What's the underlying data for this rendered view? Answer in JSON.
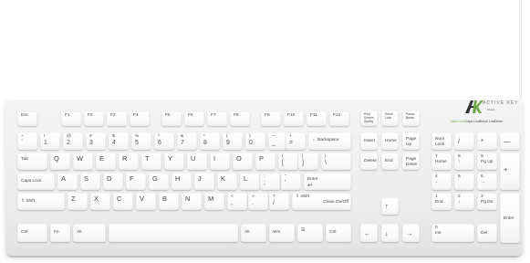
{
  "brand": {
    "name": "ACTIVE KEY",
    "sub": "Cherry"
  },
  "indicators": [
    {
      "label": "Num Lock",
      "color": "#6fa64a"
    },
    {
      "label": "Caps Lock",
      "color": "#444444"
    },
    {
      "label": "Scroll Lock",
      "color": "#444444"
    },
    {
      "label": "Clean",
      "color": "#444444"
    }
  ],
  "keys": {
    "esc": "Esc",
    "f1": "F1",
    "f2": "F2",
    "f3": "F3",
    "f4": "F4",
    "f5": "F5",
    "f6": "F6",
    "f7": "F7",
    "f8": "F8",
    "f9": "F9",
    "f10": "F10",
    "f11": "F11",
    "f12": "F12",
    "print": "Print Screen SysRq",
    "scroll": "Scroll Lock",
    "pause": "Pause Break",
    "grave": "~",
    "grave_sub": "`",
    "d1": "!",
    "d1_sub": "1",
    "d2": "@",
    "d2_sub": "2",
    "d3": "#",
    "d3_sub": "3",
    "d4": "$",
    "d4_sub": "4",
    "d5": "%",
    "d5_sub": "5",
    "d6": "^",
    "d6_sub": "6",
    "d7": "&",
    "d7_sub": "7",
    "d8": "*",
    "d8_sub": "8",
    "d9": "(",
    "d9_sub": "9",
    "d0": ")",
    "d0_sub": "0",
    "minus": "—",
    "minus_sub": "_",
    "equals": "+",
    "equals_sub": "=",
    "backspace": "← Backspace",
    "tab": "Tab",
    "q": "Q",
    "w": "W",
    "e": "E",
    "r": "R",
    "t": "T",
    "y": "Y",
    "u": "U",
    "i": "I",
    "o": "O",
    "p": "P",
    "lbracket": "{",
    "lbracket_sub": "[",
    "rbracket": "}",
    "rbracket_sub": "]",
    "backslash": "|",
    "backslash_sub": "\\",
    "caps": "Caps Lock",
    "a": "A",
    "s": "S",
    "d": "D",
    "f": "F",
    "g": "G",
    "h": "H",
    "j": "J",
    "k": "K",
    "l": "L",
    "semicolon": ":",
    "semicolon_sub": ";",
    "quote": "\"",
    "quote_sub": "'",
    "enter": "Enter",
    "lshift": "⇧ Shift",
    "z": "Z",
    "x": "X",
    "c": "C",
    "v": "V",
    "b": "B",
    "n": "N",
    "m": "M",
    "comma": "<",
    "comma_sub": ",",
    "period": ">",
    "period_sub": ".",
    "slash": "?",
    "slash_sub": "/",
    "rshift": "⇧ Shift",
    "clean": "Clean On/Off",
    "lctrl": "Ctrl",
    "fn": "Fn",
    "lalt": "Alt",
    "ralt": "Alt",
    "win": "Win",
    "menu": "☰",
    "rctrl": "Ctrl",
    "insert": "Insert",
    "home": "Home",
    "pgup": "Page Up",
    "delete": "Delete",
    "end": "End",
    "pgdn": "Page Down",
    "up": "↑",
    "left": "←",
    "down": "↓",
    "right": "→",
    "numlock": "Num Lock",
    "ndiv": "/",
    "nmul": "*",
    "nminus": "—",
    "n7": "7",
    "n7_sub": "Home",
    "n8": "8",
    "n8_sub": "↑",
    "n9": "9",
    "n9_sub": "Pg Up",
    "nplus": "+",
    "n4": "4",
    "n4_sub": "←",
    "n5": "5",
    "n6": "6",
    "n6_sub": "→",
    "n1": "1",
    "n1_sub": "End",
    "n2": "2",
    "n2_sub": "↓",
    "n3": "3",
    "n3_sub": "Pg Dn",
    "nenter": "Enter",
    "n0": "0",
    "n0_sub": "Ins",
    "ndot": ".",
    "ndot_sub": "Del"
  }
}
